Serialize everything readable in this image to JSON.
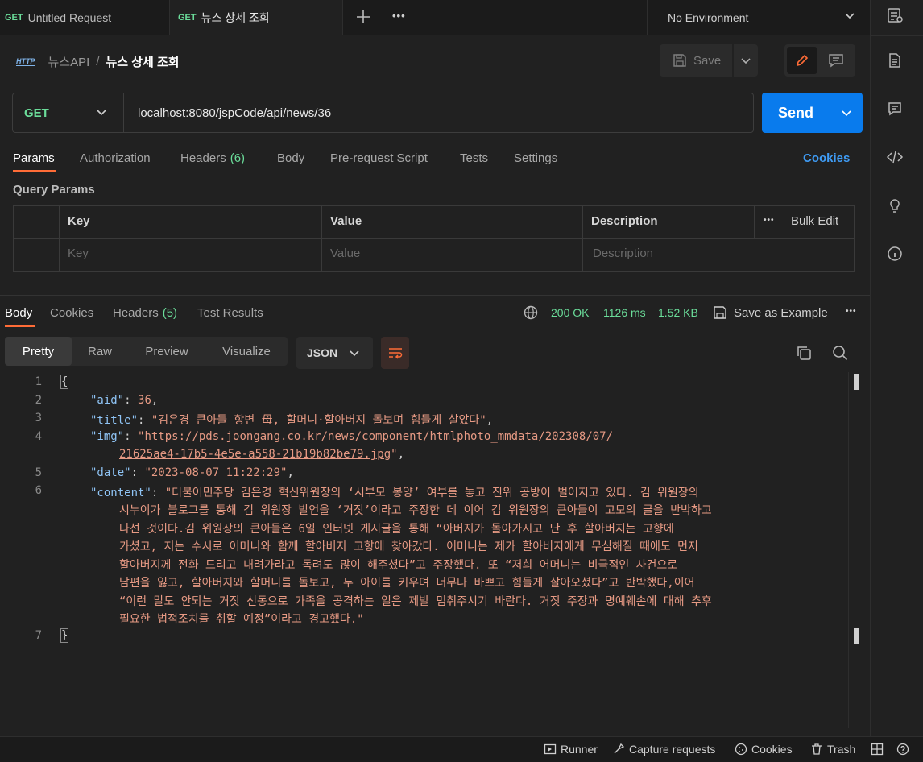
{
  "tabs": [
    {
      "method": "GET",
      "label": "Untitled Request"
    },
    {
      "method": "GET",
      "label": "뉴스 상세 조회"
    }
  ],
  "environment": "No Environment",
  "breadcrumb": {
    "badge": "HTTP",
    "collection": "뉴스API",
    "separator": "/",
    "request": "뉴스 상세 조회"
  },
  "save": {
    "label": "Save"
  },
  "request": {
    "method": "GET",
    "url": "localhost:8080/jspCode/api/news/36",
    "send_label": "Send"
  },
  "request_tabs": [
    {
      "label": "Params"
    },
    {
      "label": "Authorization"
    },
    {
      "label": "Headers",
      "count": "(6)"
    },
    {
      "label": "Body"
    },
    {
      "label": "Pre-request Script"
    },
    {
      "label": "Tests"
    },
    {
      "label": "Settings"
    }
  ],
  "cookies_link": "Cookies",
  "query_params": {
    "title": "Query Params",
    "headers": [
      "Key",
      "Value",
      "Description"
    ],
    "bulk_edit": "Bulk Edit",
    "placeholders": [
      "Key",
      "Value",
      "Description"
    ]
  },
  "response_tabs": [
    {
      "label": "Body"
    },
    {
      "label": "Cookies"
    },
    {
      "label": "Headers",
      "count": "(5)"
    },
    {
      "label": "Test Results"
    }
  ],
  "response_status": {
    "status": "200 OK",
    "time": "1126 ms",
    "size": "1.52 KB",
    "save_example": "Save as Example"
  },
  "view_modes": [
    "Pretty",
    "Raw",
    "Preview",
    "Visualize"
  ],
  "format": "JSON",
  "line_numbers": [
    "1",
    "2",
    "3",
    "4",
    "5",
    "6",
    "7"
  ],
  "body": {
    "open": "{",
    "close": "}",
    "aid_key": "\"aid\"",
    "aid_val": "36",
    "title_key": "\"title\"",
    "title_val": "\"김은경 큰아들 항변 母, 할머니·할아버지 돌보며 힘들게 살았다\"",
    "img_key": "\"img\"",
    "img_val_1": "https://pds.joongang.co.kr/news/component/htmlphoto_mmdata/202308/07/",
    "img_val_2": "21625ae4-17b5-4e5e-a558-21b19b82be79.jpg",
    "date_key": "\"date\"",
    "date_val": "\"2023-08-07 11:22:29\"",
    "content_key": "\"content\"",
    "content_lines": [
      "\"더불어민주당 김은경 혁신위원장의 ‘시부모 봉양’ 여부를 놓고 진위 공방이 벌어지고 있다. 김 위원장의",
      "시누이가 블로그를 통해 김 위원장 발언을 ‘거짓’이라고 주장한 데 이어 김 위원장의 큰아들이 고모의 글을 반박하고",
      "나선 것이다.김 위원장의 큰아들은 6일 인터넷 게시글을 통해 “아버지가 돌아가시고 난 후 할아버지는 고향에",
      "가셨고, 저는 수시로 어머니와 함께 할아버지 고향에 찾아갔다. 어머니는 제가 할아버지에게 무심해질 때에도 먼저",
      "할아버지께 전화 드리고 내려가라고 독려도 많이 해주셨다”고 주장했다. 또 “저희 어머니는 비극적인 사건으로",
      "남편을 잃고, 할아버지와 할머니를 돌보고, 두 아이를 키우며 너무나 바쁘고 힘들게 살아오셨다”고 반박했다,이어",
      "“이런 말도 안되는 거짓 선동으로 가족을 공격하는 일은 제발 멈춰주시기 바란다. 거짓 주장과 명예훼손에 대해 추후",
      "필요한 법적조치를 취할 예정”이라고 경고했다.\""
    ]
  },
  "footer": [
    {
      "icon": "runner-icon",
      "label": "Runner"
    },
    {
      "icon": "capture-icon",
      "label": "Capture requests"
    },
    {
      "icon": "cookie-icon",
      "label": "Cookies"
    },
    {
      "icon": "trash-icon",
      "label": "Trash"
    }
  ],
  "colors": {
    "accent": "#ff6c37",
    "send": "#097bed",
    "method": "#6bdd9a",
    "link": "#3f9cf5",
    "string": "#e79a84",
    "key": "#8fc4f5"
  }
}
